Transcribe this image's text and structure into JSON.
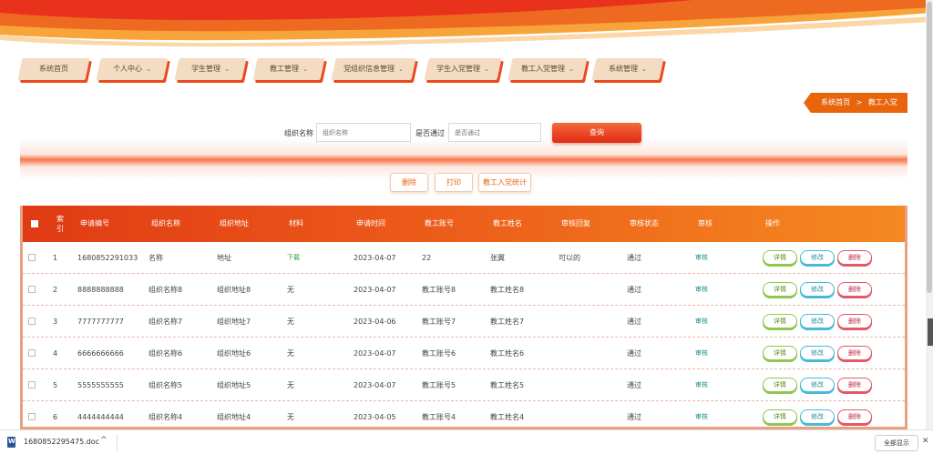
{
  "nav": {
    "items": [
      {
        "label": "系统首页",
        "has_menu": false
      },
      {
        "label": "个人中心",
        "has_menu": true
      },
      {
        "label": "学生管理",
        "has_menu": true
      },
      {
        "label": "教工管理",
        "has_menu": true
      },
      {
        "label": "党组织信息管理",
        "has_menu": true
      },
      {
        "label": "学生入党管理",
        "has_menu": true
      },
      {
        "label": "教工入党管理",
        "has_menu": true
      },
      {
        "label": "系统管理",
        "has_menu": true
      }
    ],
    "chevron": "⌄"
  },
  "breadcrumb": {
    "home": "系统首页",
    "separator": ">",
    "current": "教工入党"
  },
  "search": {
    "org_label": "组织名称",
    "org_placeholder": "组织名称",
    "pass_label": "是否通过",
    "pass_placeholder": "是否通过",
    "query_button": "查询"
  },
  "actions": {
    "delete": "删除",
    "print": "打印",
    "stats": "教工入党统计"
  },
  "table": {
    "seq_header": "索引",
    "headers": [
      "申请编号",
      "组织名称",
      "组织地址",
      "材料",
      "申请时间",
      "教工账号",
      "教工姓名",
      "审核回复",
      "审核状态",
      "审核",
      "操作"
    ],
    "op_labels": {
      "detail": "详情",
      "edit": "修改",
      "delete": "删除"
    },
    "rows": [
      {
        "seq": "1",
        "apply_no": "1680852291033",
        "org_name": "名称",
        "org_addr": "地址",
        "material": "下载",
        "apply_time": "2023-04-07",
        "account": "22",
        "name": "张翼",
        "reply": "可以的",
        "status": "通过",
        "audit": "审核"
      },
      {
        "seq": "2",
        "apply_no": "8888888888",
        "org_name": "组织名称8",
        "org_addr": "组织地址8",
        "material": "无",
        "apply_time": "2023-04-07",
        "account": "教工账号8",
        "name": "教工姓名8",
        "reply": "",
        "status": "通过",
        "audit": "审核"
      },
      {
        "seq": "3",
        "apply_no": "7777777777",
        "org_name": "组织名称7",
        "org_addr": "组织地址7",
        "material": "无",
        "apply_time": "2023-04-06",
        "account": "教工账号7",
        "name": "教工姓名7",
        "reply": "",
        "status": "通过",
        "audit": "审核"
      },
      {
        "seq": "4",
        "apply_no": "6666666666",
        "org_name": "组织名称6",
        "org_addr": "组织地址6",
        "material": "无",
        "apply_time": "2023-04-07",
        "account": "教工账号6",
        "name": "教工姓名6",
        "reply": "",
        "status": "通过",
        "audit": "审核"
      },
      {
        "seq": "5",
        "apply_no": "5555555555",
        "org_name": "组织名称5",
        "org_addr": "组织地址5",
        "material": "无",
        "apply_time": "2023-04-07",
        "account": "教工账号5",
        "name": "教工姓名5",
        "reply": "",
        "status": "通过",
        "audit": "审核"
      },
      {
        "seq": "6",
        "apply_no": "4444444444",
        "org_name": "组织名称4",
        "org_addr": "组织地址4",
        "material": "无",
        "apply_time": "2023-04-05",
        "account": "教工账号4",
        "name": "教工姓名4",
        "reply": "",
        "status": "通过",
        "audit": "审核"
      }
    ]
  },
  "download_bar": {
    "file_name": "1680852295475.doc",
    "show_all": "全部显示",
    "close": "✕",
    "chevron": "^"
  },
  "colors": {
    "primary_orange": "#e8650c",
    "header_red": "#e03a14",
    "detail_green": "#8cc850",
    "edit_blue": "#49b9d8",
    "delete_red": "#e05a6a"
  }
}
